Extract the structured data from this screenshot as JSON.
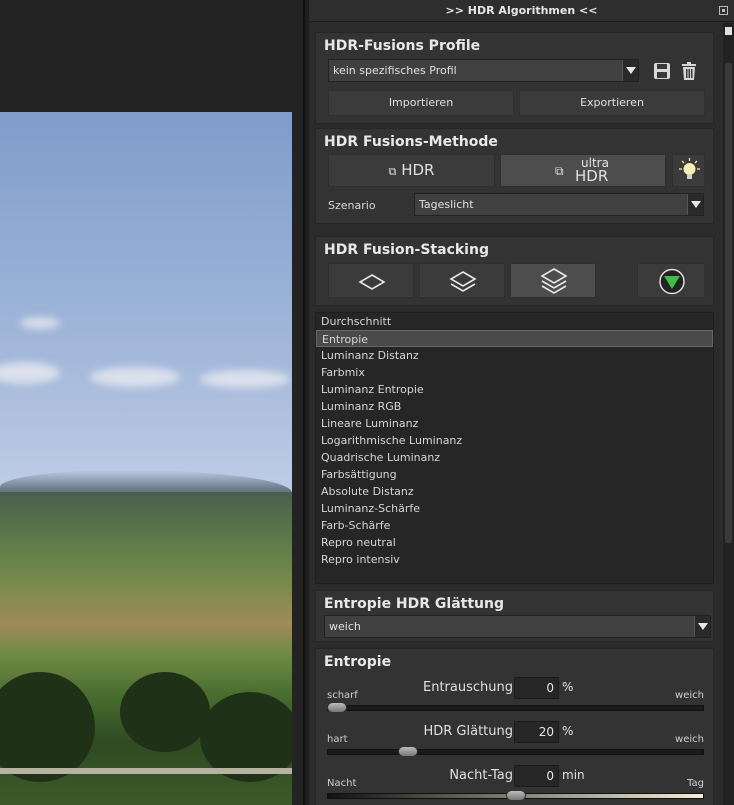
{
  "panel": {
    "title": ">> HDR Algorithmen <<"
  },
  "profile": {
    "title": "HDR-Fusions Profile",
    "selected": "kein spezifisches Profil",
    "import_label": "Importieren",
    "export_label": "Exportieren"
  },
  "method": {
    "title": "HDR Fusions-Methode",
    "hdr_label": "HDR",
    "ultra_small": "ultra",
    "ultra_big": "HDR",
    "scenario_label": "Szenario",
    "scenario_value": "Tageslicht"
  },
  "stacking": {
    "title": "HDR Fusion-Stacking",
    "items": [
      "Durchschnitt",
      "Entropie",
      "Luminanz Distanz",
      "Farbmix",
      "Luminanz Entropie",
      "Luminanz RGB",
      "Lineare Luminanz",
      "Logarithmische Luminanz",
      "Quadrische Luminanz",
      "Farbsättigung",
      "Absolute Distanz",
      "Luminanz-Schärfe",
      "Farb-Schärfe",
      "Repro neutral",
      "Repro intensiv"
    ],
    "selected_index": 1
  },
  "smoothing": {
    "title": "Entropie HDR Glättung",
    "value": "weich"
  },
  "entropie": {
    "title": "Entropie",
    "sliders": [
      {
        "name": "Entrauschung",
        "value": "0",
        "unit": "%",
        "left": "scharf",
        "right": "weich",
        "level": 0.0
      },
      {
        "name": "HDR Glättung",
        "value": "20",
        "unit": "%",
        "left": "hart",
        "right": "weich",
        "level": 0.2
      },
      {
        "name": "Nacht-Tag",
        "value": "0",
        "unit": "min",
        "left": "Nacht",
        "right": "Tag",
        "level": 0.5
      }
    ]
  },
  "colors": {
    "accent_green": "#39c24a",
    "panel_bg": "#333333",
    "selected_row": "#4a4a4a"
  }
}
